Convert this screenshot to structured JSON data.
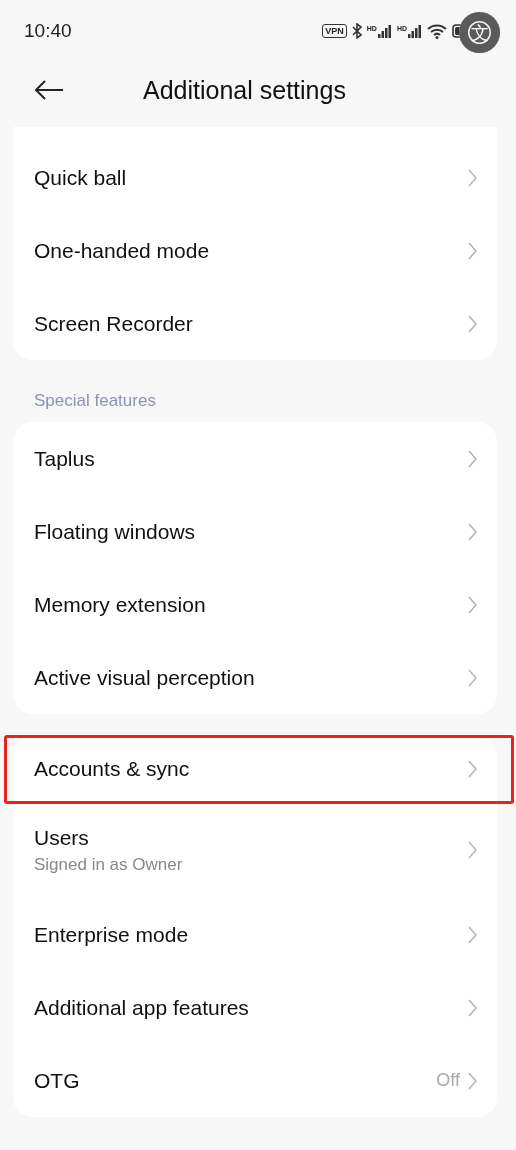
{
  "status_bar": {
    "time": "10:40",
    "vpn_badge": "VPN",
    "signals": [
      {
        "label": "HD"
      },
      {
        "label": "HD"
      }
    ]
  },
  "overlay_button": {
    "glyph": "文"
  },
  "header": {
    "title": "Additional settings"
  },
  "sections": [
    {
      "items": [
        {
          "title": "Quick ball",
          "highlighted": false
        },
        {
          "title": "One-handed mode",
          "highlighted": false
        },
        {
          "title": "Screen Recorder",
          "highlighted": false
        }
      ]
    },
    {
      "label": "Special features",
      "items": [
        {
          "title": "Taplus",
          "highlighted": false
        },
        {
          "title": "Floating windows",
          "highlighted": false
        },
        {
          "title": "Memory extension",
          "highlighted": false
        },
        {
          "title": "Active visual perception",
          "highlighted": false
        }
      ]
    },
    {
      "items": [
        {
          "title": "Accounts & sync",
          "highlighted": true
        },
        {
          "title": "Users",
          "subtitle": "Signed in as Owner",
          "highlighted": false
        },
        {
          "title": "Enterprise mode",
          "highlighted": false
        },
        {
          "title": "Additional app features",
          "highlighted": false
        },
        {
          "title": "OTG",
          "value": "Off",
          "highlighted": false
        }
      ]
    }
  ]
}
